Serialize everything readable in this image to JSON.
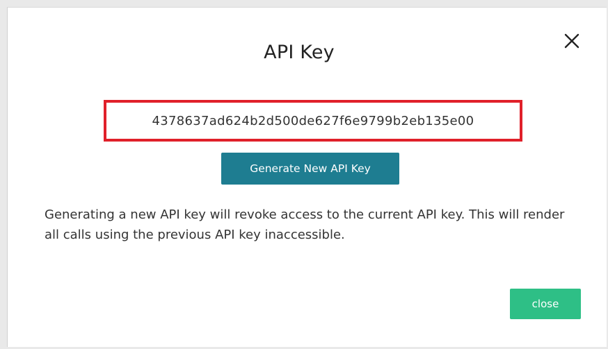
{
  "modal": {
    "title": "API Key",
    "close_icon": "close-icon",
    "api_key": "4378637ad624b2d500de627f6e9799b2eb135e00",
    "generate_button_label": "Generate New API Key",
    "description": "Generating a new API key will revoke access to the current API key. This will render all calls using the previous API key inaccessible.",
    "close_button_label": "close"
  },
  "colors": {
    "highlight_border": "#e0202a",
    "generate_button": "#1e7d91",
    "close_button": "#2ebf86"
  }
}
